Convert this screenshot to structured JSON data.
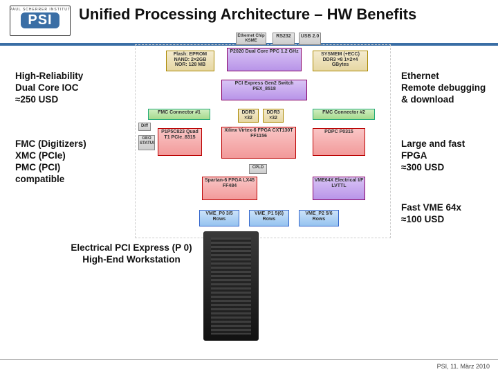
{
  "logo": {
    "top": "PAUL SCHERRER INSTITUT",
    "name": "PSI"
  },
  "title": "Unified Processing Architecture – HW Benefits",
  "annotations": {
    "a1": "High-Reliability\nDual Core IOC\n≈250 USD",
    "a2": "Ethernet\nRemote debugging\n& download",
    "a3": "FMC (Digitizers)\nXMC (PCIe)\nPMC (PCI)\ncompatible",
    "a4": "Large and fast\nFPGA\n≈300 USD",
    "a5": "Fast VME 64x\n≈100 USD",
    "a6": "Electrical PCI Express (P 0)\nHigh-End Workstation"
  },
  "diagram": {
    "flash": "Flash: EPROM\nNAND: 2×2GB\nNOR: 128 MB",
    "p2020": "P2020\nDual Core PPC 1.2 GHz",
    "sysmem": "SYSMEM (+ECC)\nDDR3 ×8\n1×2×4 GBytes",
    "ethsw": "Ethernet Chip\nKSME",
    "rs232": "RS232",
    "usb": "USB 2.0",
    "pex": "PCI Express Gen2\nSwitch\nPEX_8518",
    "fmc1": "FMC Connector #1",
    "fmc2": "FMC Connector #2",
    "ddr3a": "DDR3\n×32",
    "ddr3b": "DDR3\n×32",
    "pipe": "P1P5C823\nQuad T1\nPCIe_8315",
    "xilinx": "Xilinx\nVirtex-6 FPGA\nCXT130T\nFF1156",
    "pdpc": "PDPC P0315",
    "s6fpga": "Spartan-6 FPGA\nLX45\nFF484",
    "vme64x": "VME64X\nElectrical I/F\nLVTTL",
    "p0": "VME_P0\n3/5 Rows",
    "p1": "VME_P1\n5(6) Rows",
    "p2": "VME_P2\n5/6 Rows",
    "geo": "GEO\nSTATUS",
    "diff": "Diff",
    "cpld": "CPLD"
  },
  "footer": "PSI, 11. März 2010"
}
